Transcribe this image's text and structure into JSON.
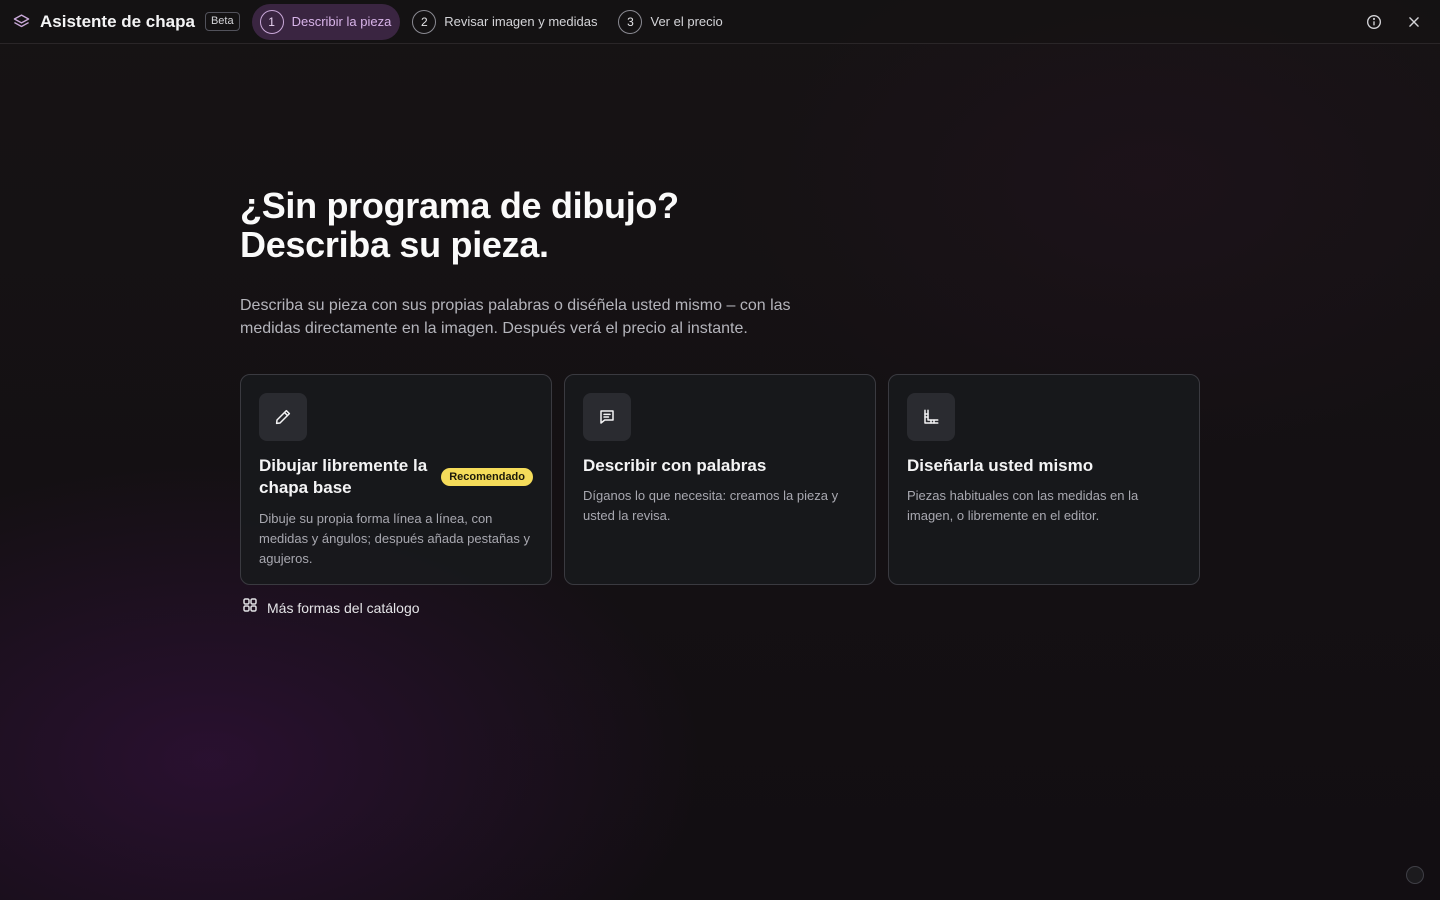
{
  "app": {
    "title": "Asistente de chapa",
    "badge": "Beta"
  },
  "steps": [
    {
      "num": "1",
      "label": "Describir la pieza",
      "active": true
    },
    {
      "num": "2",
      "label": "Revisar imagen y medidas",
      "active": false
    },
    {
      "num": "3",
      "label": "Ver el precio",
      "active": false
    }
  ],
  "hero": {
    "title_line1": "¿Sin programa de dibujo?",
    "title_line2": "Describa su pieza.",
    "subtitle": "Describa su pieza con sus propias palabras o diséñela usted mismo – con las medidas directamente en la imagen. Después verá el precio al instante."
  },
  "cards": [
    {
      "icon": "pencil-icon",
      "title": "Dibujar libremente la chapa base",
      "badge": "Recomendado",
      "description": "Dibuje su propia forma línea a línea, con medidas y ángulos; después añada pestañas y agujeros."
    },
    {
      "icon": "chat-icon",
      "title": "Describir con palabras",
      "description": "Díganos lo que necesita: creamos la pieza y usted la revisa."
    },
    {
      "icon": "ruler-corner-icon",
      "title": "Diseñarla usted mismo",
      "description": "Piezas habituales con las medidas en la imagen, o libremente en el editor."
    }
  ],
  "catalog_link": {
    "icon": "grid-icon",
    "label": "Más formas del catálogo"
  },
  "icons": {
    "info": "info-icon",
    "close": "close-icon",
    "brand": "layers-icon"
  },
  "colors": {
    "accent": "#3a2541",
    "badge": "#f5dc5a"
  }
}
